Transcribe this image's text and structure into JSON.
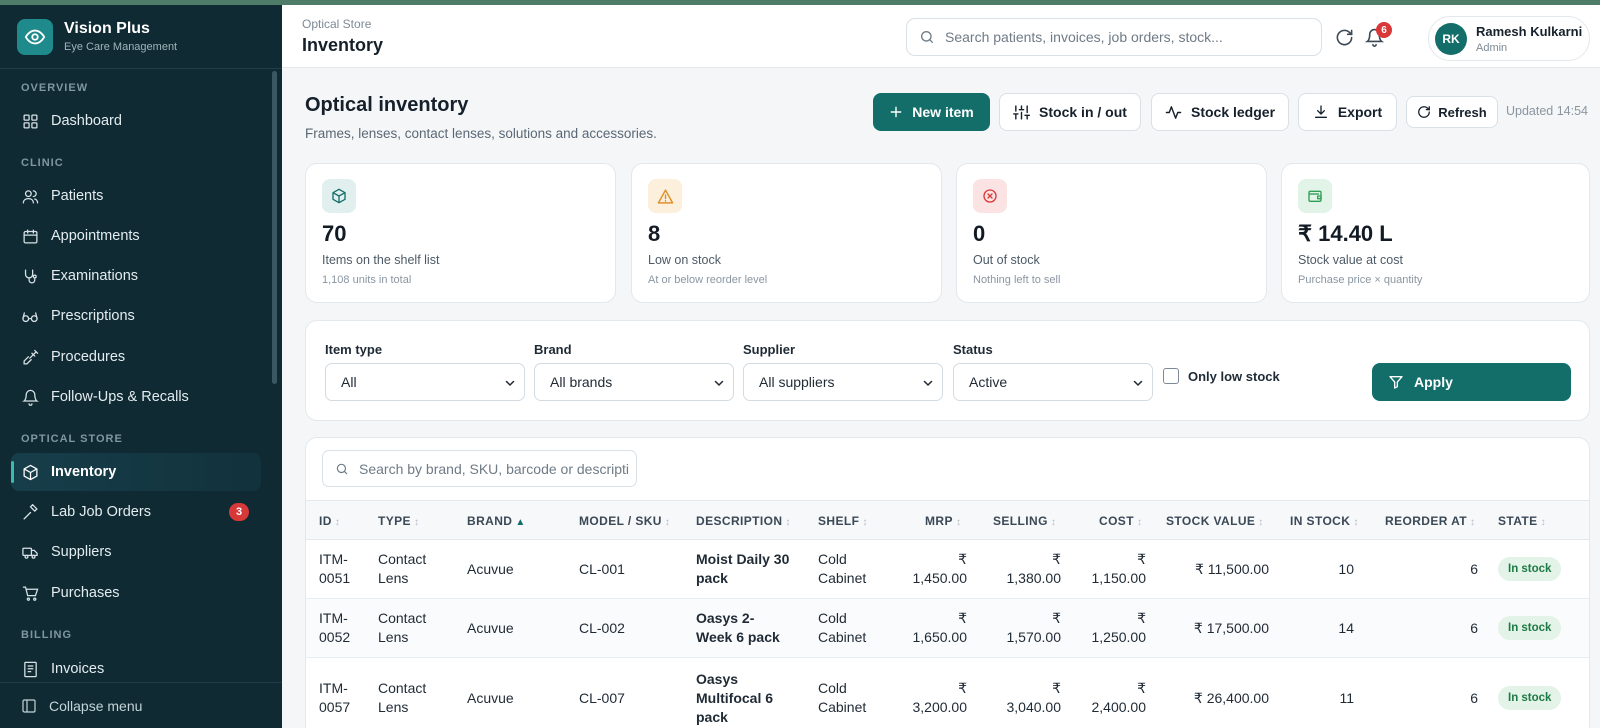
{
  "app": {
    "name": "Vision Plus",
    "subtitle": "Eye Care Management"
  },
  "sidebar": {
    "sections": {
      "overview": "OVERVIEW",
      "clinic": "CLINIC",
      "optical": "OPTICAL STORE",
      "billing": "BILLING"
    },
    "items": {
      "dashboard": "Dashboard",
      "patients": "Patients",
      "appointments": "Appointments",
      "examinations": "Examinations",
      "prescriptions": "Prescriptions",
      "procedures": "Procedures",
      "followups": "Follow-Ups & Recalls",
      "inventory": "Inventory",
      "lab_jobs": "Lab Job Orders",
      "lab_jobs_badge": "3",
      "suppliers": "Suppliers",
      "purchases": "Purchases",
      "invoices": "Invoices"
    },
    "collapse": "Collapse menu"
  },
  "header": {
    "breadcrumb": "Optical Store",
    "title": "Inventory",
    "search_placeholder": "Search patients, invoices, job orders, stock...",
    "notif_count": "6",
    "user": {
      "initials": "RK",
      "name": "Ramesh Kulkarni",
      "role": "Admin"
    }
  },
  "page": {
    "title": "Optical inventory",
    "subtitle": "Frames, lenses, contact lenses, solutions and accessories.",
    "buttons": {
      "new_item": "New item",
      "stock_inout": "Stock in / out",
      "ledger": "Stock ledger",
      "export": "Export",
      "refresh": "Refresh"
    },
    "updated": "Updated 14:54"
  },
  "stats": [
    {
      "value": "70",
      "label": "Items on the shelf list",
      "sub": "1,108 units in total",
      "color": "#136e6a"
    },
    {
      "value": "8",
      "label": "Low on stock",
      "sub": "At or below reorder level",
      "color": "#e0902a"
    },
    {
      "value": "0",
      "label": "Out of stock",
      "sub": "Nothing left to sell",
      "color": "#d93838"
    },
    {
      "value": "₹ 14.40 L",
      "label": "Stock value at cost",
      "sub": "Purchase price × quantity",
      "color": "#2f9e55"
    }
  ],
  "filters": {
    "item_type": {
      "label": "Item type",
      "value": "All"
    },
    "brand": {
      "label": "Brand",
      "value": "All brands"
    },
    "supplier": {
      "label": "Supplier",
      "value": "All suppliers"
    },
    "status": {
      "label": "Status",
      "value": "Active"
    },
    "low_stock": "Only low stock",
    "apply": "Apply"
  },
  "table": {
    "search_placeholder": "Search by brand, SKU, barcode or description",
    "columns": [
      "ID",
      "TYPE",
      "BRAND",
      "MODEL / SKU",
      "DESCRIPTION",
      "SHELF",
      "MRP",
      "SELLING",
      "COST",
      "STOCK VALUE",
      "IN STOCK",
      "REORDER AT",
      "STATE"
    ],
    "rows": [
      {
        "id1": "ITM-",
        "id2": "0051",
        "type1": "Contact",
        "type2": "Lens",
        "brand": "Acuvue",
        "sku": "CL-001",
        "desc1": "Moist Daily 30",
        "desc2": "pack",
        "desc3": "",
        "shelf1": "Cold",
        "shelf2": "Cabinet",
        "mrp": "1,450.00",
        "selling": "1,380.00",
        "cost": "1,150.00",
        "value": "₹ 11,500.00",
        "stock": "10",
        "reorder": "6",
        "state": "In stock"
      },
      {
        "id1": "ITM-",
        "id2": "0052",
        "type1": "Contact",
        "type2": "Lens",
        "brand": "Acuvue",
        "sku": "CL-002",
        "desc1": "Oasys 2-",
        "desc2": "Week 6 pack",
        "desc3": "",
        "shelf1": "Cold",
        "shelf2": "Cabinet",
        "mrp": "1,650.00",
        "selling": "1,570.00",
        "cost": "1,250.00",
        "value": "₹ 17,500.00",
        "stock": "14",
        "reorder": "6",
        "state": "In stock"
      },
      {
        "id1": "ITM-",
        "id2": "0057",
        "type1": "Contact",
        "type2": "Lens",
        "brand": "Acuvue",
        "sku": "CL-007",
        "desc1": "Oasys",
        "desc2": "Multifocal 6",
        "desc3": "pack",
        "shelf1": "Cold",
        "shelf2": "Cabinet",
        "mrp": "3,200.00",
        "selling": "3,040.00",
        "cost": "2,400.00",
        "value": "₹ 26,400.00",
        "stock": "11",
        "reorder": "6",
        "state": "In stock"
      }
    ],
    "currency": "₹"
  }
}
